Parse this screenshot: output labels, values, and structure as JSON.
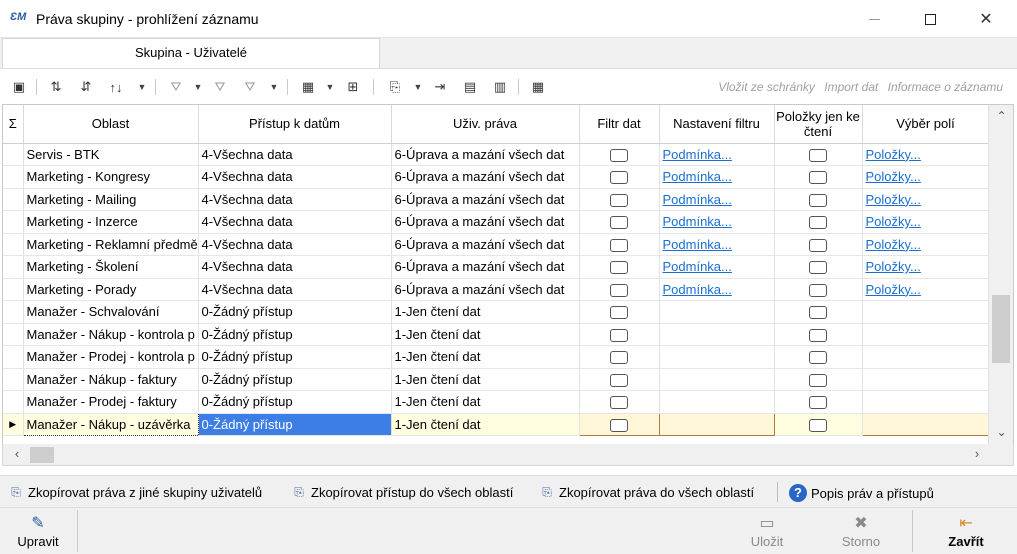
{
  "window": {
    "app_icon": "ƐM",
    "title": "Práva skupiny - prohlížení záznamu",
    "minimize_icon": "minimize-icon",
    "maximize_icon": "maximize-icon",
    "close_glyph": "✕"
  },
  "tabs": [
    {
      "label": "Skupina - Uživatelé",
      "active": true
    }
  ],
  "toolbar": {
    "links": {
      "paste_from_clipboard": "Vložit ze schránky",
      "paste_underline": "V",
      "paste_rest": "ložit",
      "paste_tail": "ze schránky",
      "import": "Import dat",
      "import_underline": "Import",
      "import_tail": "dat",
      "info": "Informace o záznamu",
      "info_underline": "Informace",
      "info_tail": "o záznamu"
    }
  },
  "grid": {
    "sigma": "Σ",
    "columns": [
      {
        "label": "Oblast"
      },
      {
        "label": "Přístup k datům"
      },
      {
        "label": "Uživ. práva"
      },
      {
        "label": "Filtr dat"
      },
      {
        "label": "Nastavení filtru"
      },
      {
        "label": "Položky jen ke čtení"
      },
      {
        "label": "Výběr polí"
      }
    ],
    "rows": [
      {
        "oblast": "Servis - BTK",
        "pristup": "4-Všechna data",
        "prava": "6-Úprava a mazání všech dat",
        "filtr_link": "Podmínka...",
        "polozky_link": "Položky..."
      },
      {
        "oblast": "Marketing - Kongresy",
        "pristup": "4-Všechna data",
        "prava": "6-Úprava a mazání všech dat",
        "filtr_link": "Podmínka...",
        "polozky_link": "Položky..."
      },
      {
        "oblast": "Marketing - Mailing",
        "pristup": "4-Všechna data",
        "prava": "6-Úprava a mazání všech dat",
        "filtr_link": "Podmínka...",
        "polozky_link": "Položky..."
      },
      {
        "oblast": "Marketing - Inzerce",
        "pristup": "4-Všechna data",
        "prava": "6-Úprava a mazání všech dat",
        "filtr_link": "Podmínka...",
        "polozky_link": "Položky..."
      },
      {
        "oblast": "Marketing - Reklamní předmě",
        "pristup": "4-Všechna data",
        "prava": "6-Úprava a mazání všech dat",
        "filtr_link": "Podmínka...",
        "polozky_link": "Položky..."
      },
      {
        "oblast": "Marketing - Školení",
        "pristup": "4-Všechna data",
        "prava": "6-Úprava a mazání všech dat",
        "filtr_link": "Podmínka...",
        "polozky_link": "Položky..."
      },
      {
        "oblast": "Marketing - Porady",
        "pristup": "4-Všechna data",
        "prava": "6-Úprava a mazání všech dat",
        "filtr_link": "Podmínka...",
        "polozky_link": "Položky..."
      },
      {
        "oblast": "Manažer - Schvalování",
        "pristup": "0-Žádný přístup",
        "prava": "1-Jen čtení dat",
        "filtr_link": "",
        "polozky_link": ""
      },
      {
        "oblast": "Manažer - Nákup - kontrola p",
        "pristup": "0-Žádný přístup",
        "prava": "1-Jen čtení dat",
        "filtr_link": "",
        "polozky_link": ""
      },
      {
        "oblast": "Manažer - Prodej - kontrola p",
        "pristup": "0-Žádný přístup",
        "prava": "1-Jen čtení dat",
        "filtr_link": "",
        "polozky_link": ""
      },
      {
        "oblast": "Manažer - Nákup - faktury",
        "pristup": "0-Žádný přístup",
        "prava": "1-Jen čtení dat",
        "filtr_link": "",
        "polozky_link": ""
      },
      {
        "oblast": "Manažer - Prodej - faktury",
        "pristup": "0-Žádný přístup",
        "prava": "1-Jen čtení dat",
        "filtr_link": "",
        "polozky_link": ""
      },
      {
        "oblast": "Manažer - Nákup - uzávěrka",
        "pristup": "0-Žádný přístup",
        "prava": "1-Jen čtení dat",
        "filtr_link": "",
        "polozky_link": ""
      }
    ]
  },
  "actions": {
    "copy_from_group": "Zkopírovat práva z jiné skupiny uživatelů",
    "copy_access_all": "Zkopírovat přístup do všech oblastí",
    "copy_rights_all": "Zkopírovat práva do všech oblastí",
    "help": "Popis práv a přístupů"
  },
  "bottom": {
    "edit": "Upravit",
    "save": "Uložit",
    "cancel": "Storno",
    "close": "Zavřít"
  },
  "colors": {
    "link": "#1a6fd0",
    "selection": "#3c7de6",
    "selected_row": "#fffde0"
  }
}
